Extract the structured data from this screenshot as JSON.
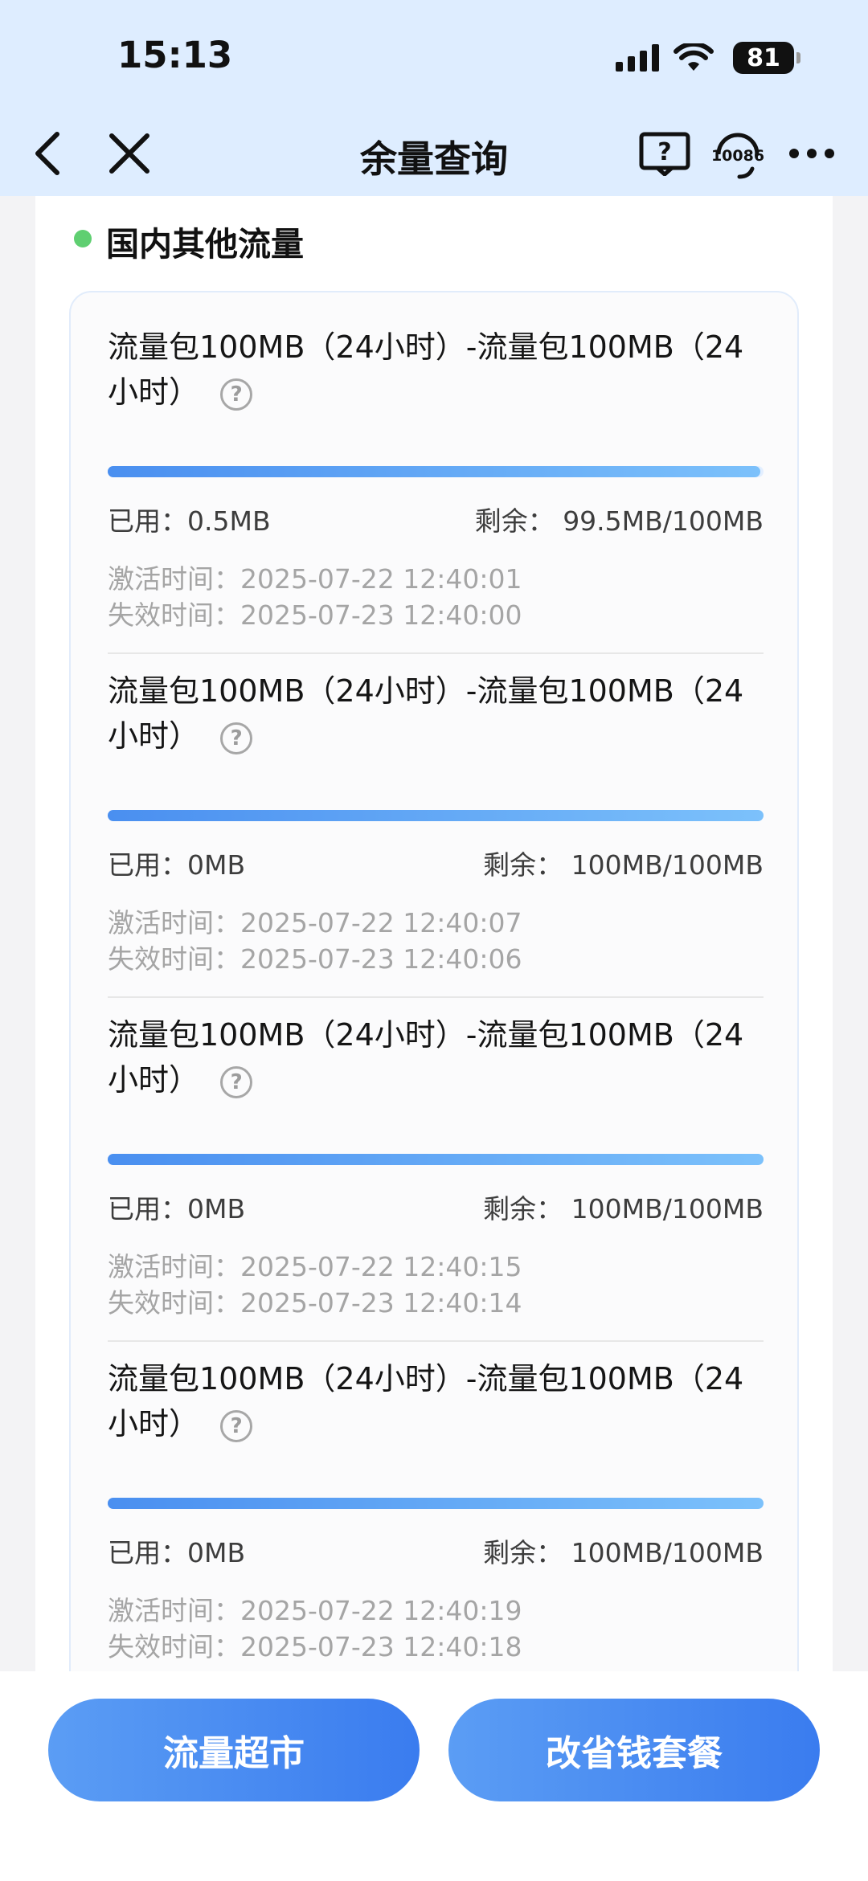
{
  "status_bar": {
    "time": "15:13",
    "battery": "81"
  },
  "nav": {
    "title": "余量查询",
    "service_number": "10086"
  },
  "section": {
    "title": "国内其他流量"
  },
  "items": [
    {
      "title": "流量包100MB（24小时）-流量包100MB（24",
      "title_cont": "小时）",
      "used": "已用：0.5MB",
      "remain_label": "剩余：",
      "remain_value": "99.5MB/100MB",
      "remaining_fraction": 0.995,
      "activated": "激活时间：2025-07-22 12:40:01",
      "expires": "失效时间：2025-07-23 12:40:00"
    },
    {
      "title": "流量包100MB（24小时）-流量包100MB（24",
      "title_cont": "小时）",
      "used": "已用：0MB",
      "remain_label": "剩余：",
      "remain_value": "100MB/100MB",
      "remaining_fraction": 1.0,
      "activated": "激活时间：2025-07-22 12:40:07",
      "expires": "失效时间：2025-07-23 12:40:06"
    },
    {
      "title": "流量包100MB（24小时）-流量包100MB（24",
      "title_cont": "小时）",
      "used": "已用：0MB",
      "remain_label": "剩余：",
      "remain_value": "100MB/100MB",
      "remaining_fraction": 1.0,
      "activated": "激活时间：2025-07-22 12:40:15",
      "expires": "失效时间：2025-07-23 12:40:14"
    },
    {
      "title": "流量包100MB（24小时）-流量包100MB（24",
      "title_cont": "小时）",
      "used": "已用：0MB",
      "remain_label": "剩余：",
      "remain_value": "100MB/100MB",
      "remaining_fraction": 1.0,
      "activated": "激活时间：2025-07-22 12:40:19",
      "expires": "失效时间：2025-07-23 12:40:18"
    }
  ],
  "buttons": {
    "market": "流量超市",
    "save_plan": "改省钱套餐"
  },
  "colors": {
    "header_bg": "#deedff",
    "accent": "#3a7cef",
    "dot": "#5fcf71"
  }
}
